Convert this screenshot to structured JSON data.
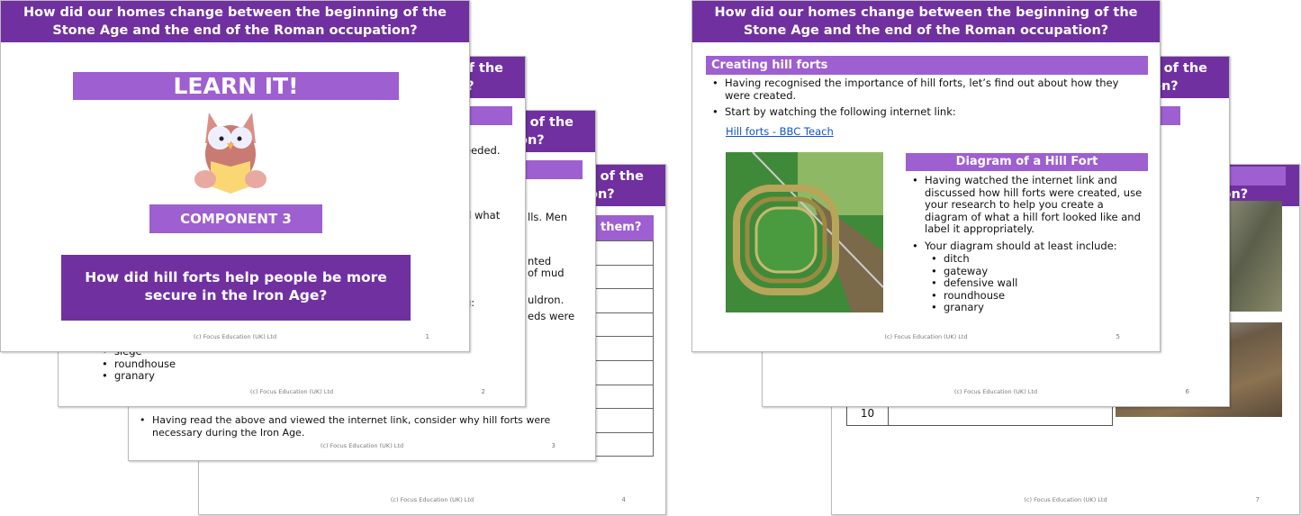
{
  "slide_title": "How did our homes change between the beginning of the Stone Age and the end of the Roman occupation?",
  "footer": "(c) Focus Education (UK) Ltd",
  "colors": {
    "header": "#7030a0",
    "subheader": "#9e5fd0",
    "link": "#1155cc"
  },
  "slide1": {
    "banner": "LEARN IT!",
    "component": "COMPONENT 3",
    "question": "How did hill forts help people be more secure in the Iron Age?",
    "page": "1",
    "icon": "owl-reading-book-icon"
  },
  "slide2": {
    "fragments": [
      "eeded.",
      "d what",
      "g:"
    ],
    "list": [
      "siege",
      "roundhouse",
      "granary"
    ],
    "page": "2"
  },
  "slide3": {
    "fragments": [
      "lls. Men",
      "nted",
      "of mud",
      "uldron.",
      "eds were"
    ],
    "bullet": "Having read the above and viewed the internet link, consider why hill forts were necessary during the Iron Age.",
    "page": "3"
  },
  "slide4": {
    "table_header": "them?",
    "page": "4"
  },
  "slide5": {
    "section": "Creating hill forts",
    "bullets": [
      "Having recognised the importance of hill forts, let’s find out about how they were created.",
      "Start by watching the following internet link:"
    ],
    "link": "Hill forts - BBC Teach",
    "diagram_title": "Diagram of a Hill Fort",
    "diagram_bullets": [
      "Having watched the internet link and discussed how hill forts were created, use your research to help you create a diagram of what a hill fort looked like and label it appropriately.",
      "Your diagram should at least include:"
    ],
    "include": [
      "ditch",
      "gateway",
      "defensive wall",
      "roundhouse",
      "granary"
    ],
    "page": "5"
  },
  "slide6": {
    "page": "6"
  },
  "slide7": {
    "row_number": "10",
    "page": "7"
  }
}
